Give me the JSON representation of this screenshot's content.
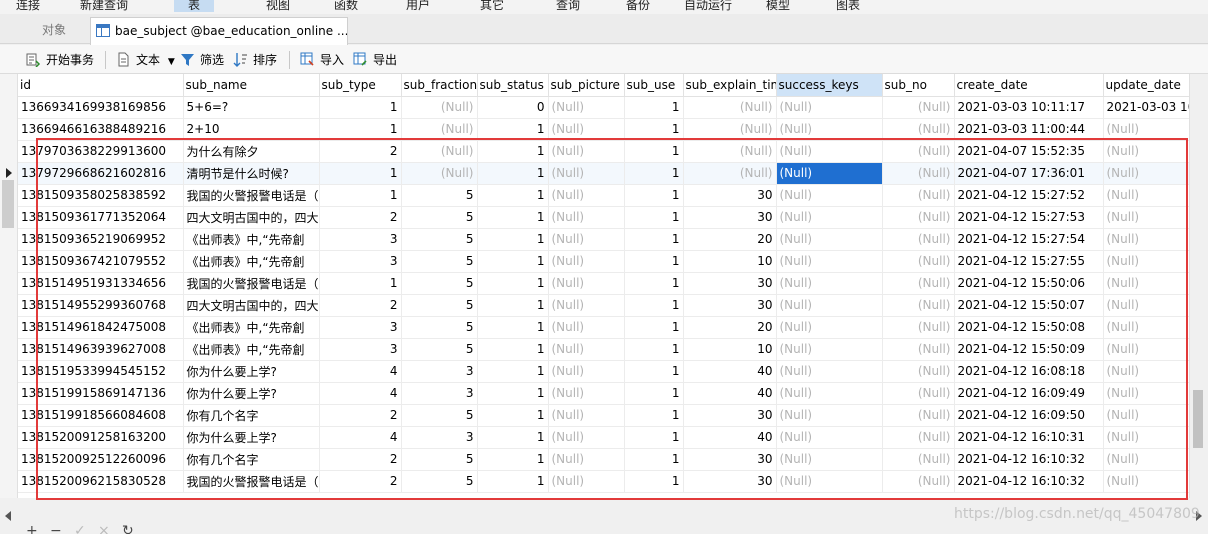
{
  "menu": [
    "连接",
    "新建查询",
    "表",
    "视图",
    "函数",
    "用户",
    "其它",
    "查询",
    "备份",
    "自动运行",
    "模型",
    "图表"
  ],
  "tabs": {
    "objects": "对象",
    "active": "bae_subject @bae_education_online ..."
  },
  "toolbar": {
    "begin_transaction": "开始事务",
    "text": "文本",
    "filter": "筛选",
    "sort": "排序",
    "import": "导入",
    "export": "导出"
  },
  "columns": [
    "id",
    "sub_name",
    "sub_type",
    "sub_fraction",
    "sub_status",
    "sub_picture",
    "sub_use",
    "sub_explain_tim",
    "success_keys",
    "sub_no",
    "create_date",
    "update_date"
  ],
  "rows": [
    [
      "1366934169938169856",
      "5+6=?",
      "1",
      "(Null)",
      "0",
      "(Null)",
      "1",
      "(Null)",
      "(Null)",
      "(Null)",
      "2021-03-03 10:11:17",
      "2021-03-03 10"
    ],
    [
      "1366946616388489216",
      "2+10",
      "1",
      "(Null)",
      "1",
      "(Null)",
      "1",
      "(Null)",
      "(Null)",
      "(Null)",
      "2021-03-03 11:00:44",
      "(Null)"
    ],
    [
      "1379703638229913600",
      "为什么有除夕",
      "2",
      "(Null)",
      "1",
      "(Null)",
      "1",
      "(Null)",
      "(Null)",
      "(Null)",
      "2021-04-07 15:52:35",
      "(Null)"
    ],
    [
      "1379729668621602816",
      "清明节是什么时候?",
      "1",
      "(Null)",
      "1",
      "(Null)",
      "1",
      "(Null)",
      "(Null)",
      "(Null)",
      "2021-04-07 17:36:01",
      "(Null)"
    ],
    [
      "1381509358025838592",
      "我国的火警报警电话是（",
      "1",
      "5",
      "1",
      "(Null)",
      "1",
      "30",
      "(Null)",
      "(Null)",
      "2021-04-12 15:27:52",
      "(Null)"
    ],
    [
      "1381509361771352064",
      "四大文明古国中的，四大",
      "2",
      "5",
      "1",
      "(Null)",
      "1",
      "30",
      "(Null)",
      "(Null)",
      "2021-04-12 15:27:53",
      "(Null)"
    ],
    [
      "1381509365219069952",
      "《出师表》中,“先帝創",
      "3",
      "5",
      "1",
      "(Null)",
      "1",
      "20",
      "(Null)",
      "(Null)",
      "2021-04-12 15:27:54",
      "(Null)"
    ],
    [
      "1381509367421079552",
      "《出师表》中,“先帝創",
      "3",
      "5",
      "1",
      "(Null)",
      "1",
      "10",
      "(Null)",
      "(Null)",
      "2021-04-12 15:27:55",
      "(Null)"
    ],
    [
      "1381514951931334656",
      "我国的火警报警电话是（",
      "1",
      "5",
      "1",
      "(Null)",
      "1",
      "30",
      "(Null)",
      "(Null)",
      "2021-04-12 15:50:06",
      "(Null)"
    ],
    [
      "1381514955299360768",
      "四大文明古国中的，四大",
      "2",
      "5",
      "1",
      "(Null)",
      "1",
      "30",
      "(Null)",
      "(Null)",
      "2021-04-12 15:50:07",
      "(Null)"
    ],
    [
      "1381514961842475008",
      "《出师表》中,“先帝創",
      "3",
      "5",
      "1",
      "(Null)",
      "1",
      "20",
      "(Null)",
      "(Null)",
      "2021-04-12 15:50:08",
      "(Null)"
    ],
    [
      "1381514963939627008",
      "《出师表》中,“先帝創",
      "3",
      "5",
      "1",
      "(Null)",
      "1",
      "10",
      "(Null)",
      "(Null)",
      "2021-04-12 15:50:09",
      "(Null)"
    ],
    [
      "1381519533994545152",
      "你为什么要上学?",
      "4",
      "3",
      "1",
      "(Null)",
      "1",
      "40",
      "(Null)",
      "(Null)",
      "2021-04-12 16:08:18",
      "(Null)"
    ],
    [
      "1381519915869147136",
      "你为什么要上学?",
      "4",
      "3",
      "1",
      "(Null)",
      "1",
      "40",
      "(Null)",
      "(Null)",
      "2021-04-12 16:09:49",
      "(Null)"
    ],
    [
      "1381519918566084608",
      "你有几个名字",
      "2",
      "5",
      "1",
      "(Null)",
      "1",
      "30",
      "(Null)",
      "(Null)",
      "2021-04-12 16:09:50",
      "(Null)"
    ],
    [
      "1381520091258163200",
      "你为什么要上学?",
      "4",
      "3",
      "1",
      "(Null)",
      "1",
      "40",
      "(Null)",
      "(Null)",
      "2021-04-12 16:10:31",
      "(Null)"
    ],
    [
      "1381520092512260096",
      "你有几个名字",
      "2",
      "5",
      "1",
      "(Null)",
      "1",
      "30",
      "(Null)",
      "(Null)",
      "2021-04-12 16:10:32",
      "(Null)"
    ],
    [
      "1381520096215830528",
      "我国的火警报警电话是（",
      "2",
      "5",
      "1",
      "(Null)",
      "1",
      "30",
      "(Null)",
      "(Null)",
      "2021-04-12 16:10:32",
      "(Null)"
    ]
  ],
  "numeric_columns": [
    2,
    3,
    4,
    6,
    7,
    9
  ],
  "current_row": 3,
  "selected_cell": {
    "row": 3,
    "col": 8
  },
  "watermark": "https://blog.csdn.net/qq_45047809",
  "colors": {
    "highlight": "#1f6fd1",
    "box": "#e23a3a",
    "null_text": "#b4b4b4"
  }
}
